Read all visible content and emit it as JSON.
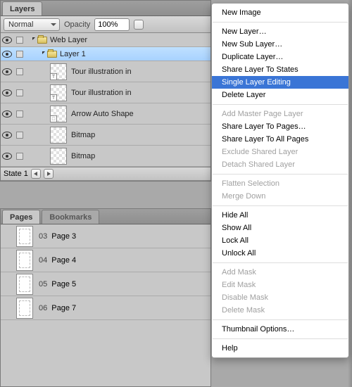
{
  "layersPanel": {
    "tab": "Layers",
    "blendMode": "Normal",
    "opacityLabel": "Opacity",
    "opacityValue": "100%",
    "rows": [
      {
        "label": "Web Layer",
        "type": "folder",
        "indent": 0,
        "selected": false,
        "big": false,
        "eye": true
      },
      {
        "label": "Layer 1",
        "type": "folder",
        "indent": 1,
        "selected": true,
        "big": false,
        "eye": true
      },
      {
        "label": "Tour illustration in",
        "type": "thumb",
        "badge": "T",
        "indent": 2,
        "big": true,
        "eye": true
      },
      {
        "label": "Tour illustration in",
        "type": "thumb",
        "badge": "T",
        "indent": 2,
        "big": true,
        "eye": true
      },
      {
        "label": "Arrow Auto Shape",
        "type": "thumb",
        "badge": "□",
        "indent": 2,
        "big": true,
        "eye": true
      },
      {
        "label": "Bitmap",
        "type": "thumb",
        "badge": "",
        "indent": 2,
        "big": true,
        "eye": true
      },
      {
        "label": "Bitmap",
        "type": "thumb",
        "badge": "",
        "indent": 2,
        "big": true,
        "eye": true
      }
    ],
    "state": "State 1"
  },
  "pagesPanel": {
    "tabs": [
      "Pages",
      "Bookmarks"
    ],
    "activeTab": 0,
    "pages": [
      {
        "num": "03",
        "name": "Page 3"
      },
      {
        "num": "04",
        "name": "Page 4"
      },
      {
        "num": "05",
        "name": "Page 5"
      },
      {
        "num": "06",
        "name": "Page 7"
      }
    ]
  },
  "menu": {
    "groups": [
      [
        {
          "t": "New Image",
          "d": false
        }
      ],
      [
        {
          "t": "New Layer…",
          "d": false
        },
        {
          "t": "New Sub Layer…",
          "d": false
        },
        {
          "t": "Duplicate Layer…",
          "d": false
        },
        {
          "t": "Share Layer To States",
          "d": false
        },
        {
          "t": "Single Layer Editing",
          "d": false,
          "sel": true
        },
        {
          "t": "Delete Layer",
          "d": false
        }
      ],
      [
        {
          "t": "Add Master Page Layer",
          "d": true
        },
        {
          "t": "Share Layer To Pages…",
          "d": false
        },
        {
          "t": "Share Layer To All Pages",
          "d": false
        },
        {
          "t": "Exclude Shared Layer",
          "d": true
        },
        {
          "t": "Detach Shared Layer",
          "d": true
        }
      ],
      [
        {
          "t": "Flatten Selection",
          "d": true
        },
        {
          "t": "Merge Down",
          "d": true
        }
      ],
      [
        {
          "t": "Hide All",
          "d": false
        },
        {
          "t": "Show All",
          "d": false
        },
        {
          "t": "Lock All",
          "d": false
        },
        {
          "t": "Unlock All",
          "d": false
        }
      ],
      [
        {
          "t": "Add Mask",
          "d": true
        },
        {
          "t": "Edit Mask",
          "d": true
        },
        {
          "t": "Disable Mask",
          "d": true
        },
        {
          "t": "Delete Mask",
          "d": true
        }
      ],
      [
        {
          "t": "Thumbnail Options…",
          "d": false
        }
      ],
      [
        {
          "t": "Help",
          "d": false
        }
      ]
    ]
  }
}
